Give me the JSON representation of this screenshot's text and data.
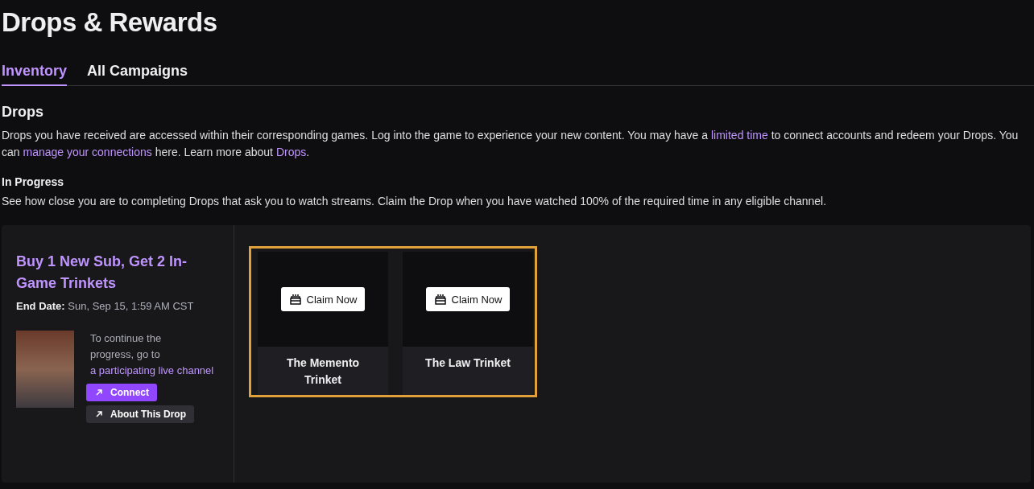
{
  "page_title": "Drops & Rewards",
  "tabs": [
    {
      "label": "Inventory",
      "selected": true
    },
    {
      "label": "All Campaigns",
      "selected": false
    }
  ],
  "drops_section": {
    "heading": "Drops",
    "paragraph": [
      {
        "kind": "text",
        "text": "Drops you have received are accessed within their corresponding games. Log into the game to experience your new content. You may have a "
      },
      {
        "kind": "link",
        "text": "limited time"
      },
      {
        "kind": "text",
        "text": " to connect accounts and redeem your Drops. You can "
      },
      {
        "kind": "link",
        "text": "manage your connections"
      },
      {
        "kind": "text",
        "text": " here. Learn more about "
      },
      {
        "kind": "link",
        "text": "Drops"
      },
      {
        "kind": "text",
        "text": "."
      }
    ]
  },
  "in_progress": {
    "heading": "In Progress",
    "description": "See how close you are to completing Drops that ask you to watch streams. Claim the Drop when you have watched 100% of the required time in any eligible channel."
  },
  "campaign": {
    "title": "Buy 1 New Sub, Get 2 In-Game Trinkets",
    "end_date_label": "End Date:",
    "end_date": "Sun, Sep 15, 1:59 AM CST",
    "instructions": [
      {
        "kind": "text",
        "text": "To continue the progress, go to "
      },
      {
        "kind": "link",
        "text": "a participating live channel"
      }
    ],
    "buttons": [
      {
        "label": "Connect",
        "kind": "primary"
      },
      {
        "label": "About This Drop",
        "kind": "secondary"
      }
    ],
    "rewards": [
      {
        "name": "The Memento Trinket",
        "action": "Claim Now"
      },
      {
        "name": "The Law Trinket",
        "action": "Claim Now"
      }
    ]
  }
}
